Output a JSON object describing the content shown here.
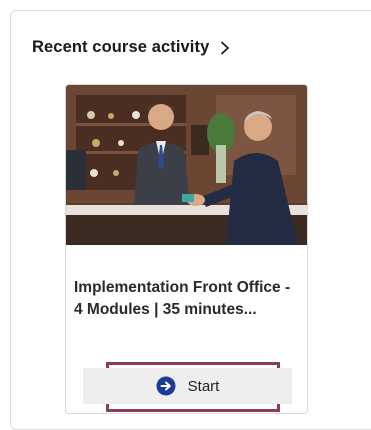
{
  "section": {
    "title": "Recent course activity",
    "chevron_icon": "chevron-right-icon"
  },
  "card": {
    "image_subject": "hotel-reception-photo",
    "title": "Implementation Front Office - 4 Modules | 35 minutes...",
    "start_label": "Start",
    "start_icon": "arrow-right-circle-icon"
  },
  "colors": {
    "accent": "#1b3a9a",
    "focus_outline": "#8d3a5c",
    "button_bg": "#eeeeee"
  }
}
